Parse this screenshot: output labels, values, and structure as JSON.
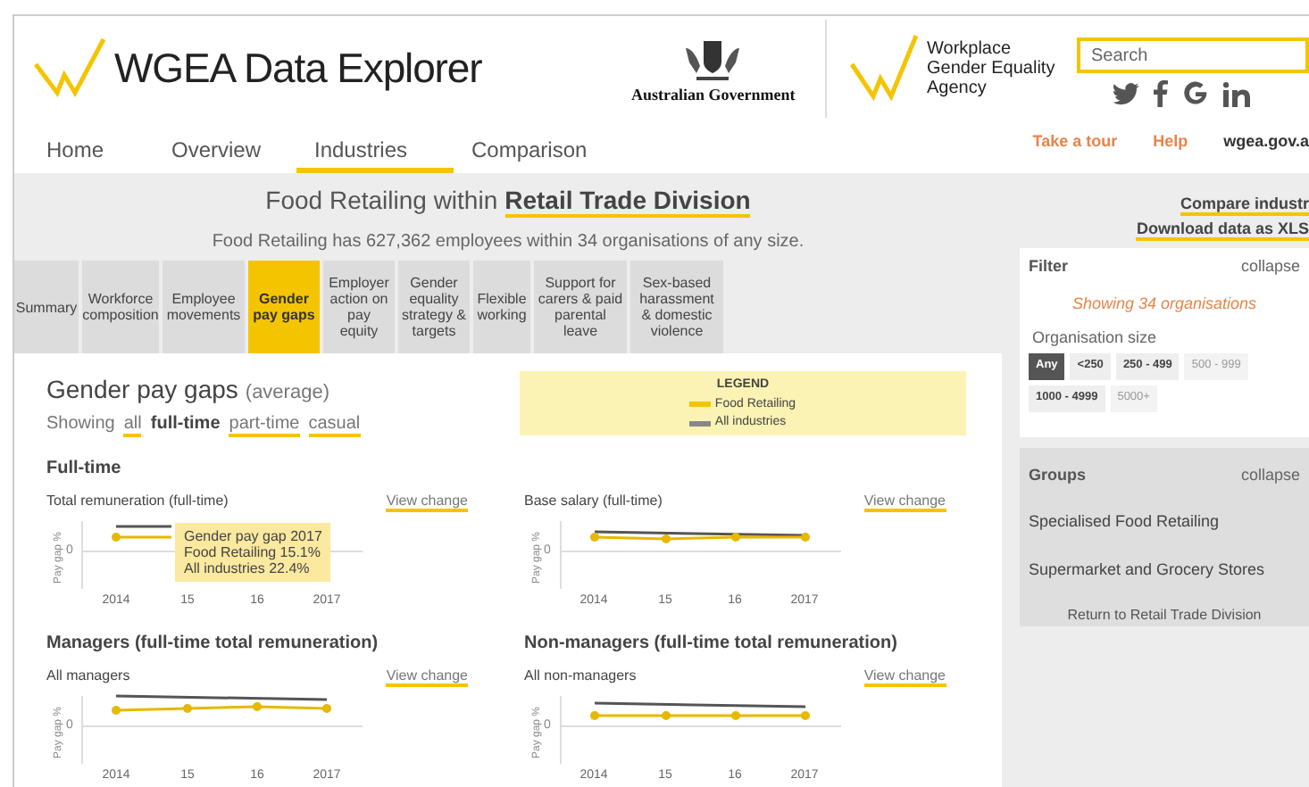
{
  "header": {
    "logo_text": "WGEA Data Explorer",
    "government": "Australian Government",
    "agency": [
      "Workplace",
      "Gender Equality",
      "Agency"
    ],
    "search": {
      "placeholder": "Search"
    }
  },
  "nav": {
    "tabs": [
      {
        "label": "Home",
        "selected": false
      },
      {
        "label": "Overview",
        "selected": false
      },
      {
        "label": "Industries",
        "selected": true
      },
      {
        "label": "Comparison",
        "selected": false
      }
    ],
    "links": [
      "Take a tour",
      "Help",
      "wgea.gov.a"
    ]
  },
  "title": {
    "prefix": "Food Retailing within",
    "link": "Retail Trade Division"
  },
  "subtitle": "Food Retailing has 627,362 employees within 34 organisations of any size.",
  "section_tabs": [
    {
      "label": "Summary",
      "selected": false
    },
    {
      "label": "Workforce composition",
      "selected": false
    },
    {
      "label": "Employee movements",
      "selected": false
    },
    {
      "label": "Gender pay gaps",
      "selected": true
    },
    {
      "label": "Employer action on pay equity",
      "selected": false
    },
    {
      "label": "Gender equality strategy & targets",
      "selected": false
    },
    {
      "label": "Flexible working",
      "selected": false
    },
    {
      "label": "Support for carers & paid parental leave",
      "selected": false
    },
    {
      "label": "Sex-based harassment & domestic violence",
      "selected": false
    }
  ],
  "content": {
    "heading": "Gender pay gaps",
    "heading_note": "(average)",
    "showing_label": "Showing",
    "filters": [
      {
        "label": "all",
        "selected": false
      },
      {
        "label": "full-time",
        "selected": true
      },
      {
        "label": "part-time",
        "selected": false
      },
      {
        "label": "casual",
        "selected": false
      }
    ],
    "legend": {
      "title": "LEGEND",
      "items": [
        {
          "label": "Food Retailing",
          "color": "#f5c400"
        },
        {
          "label": "All industries",
          "color": "#888888"
        }
      ]
    },
    "chart_rows": [
      {
        "heading": "Full-time",
        "charts": [
          {
            "title": "Total remuneration (full-time)",
            "link": "View change",
            "y_label": "Pay gap %",
            "zero": "0",
            "x_labels": [
              "2014",
              "15",
              "16",
              "2017"
            ],
            "tooltip": [
              "Gender pay gap 2017",
              "Food Retailing 15.1%",
              "All industries 22.4%"
            ]
          },
          {
            "title": "Base salary (full-time)",
            "link": "View change",
            "y_label": "Pay gap %",
            "zero": "0",
            "x_labels": [
              "2014",
              "15",
              "16",
              "2017"
            ]
          }
        ]
      },
      {
        "charts": [
          {
            "heading": "Managers (full-time total remuneration)",
            "title": "All managers",
            "link": "View change",
            "y_label": "Pay gap %",
            "zero": "0",
            "x_labels": [
              "2014",
              "15",
              "16",
              "2017"
            ]
          },
          {
            "heading": "Non-managers (full-time total remuneration)",
            "title": "All non-managers",
            "link": "View change",
            "y_label": "Pay gap %",
            "zero": "0",
            "x_labels": [
              "2014",
              "15",
              "16",
              "2017"
            ]
          }
        ]
      }
    ]
  },
  "sidebar": {
    "links": [
      "Compare industr",
      "Download data as XLS"
    ],
    "filter": {
      "title": "Filter",
      "collapse": "collapse",
      "status": "Showing 34 organisations",
      "size_label": "Organisation size",
      "sizes": [
        {
          "label": "Any",
          "selected": true,
          "disabled": false
        },
        {
          "label": "<250",
          "selected": false,
          "disabled": false
        },
        {
          "label": "250 - 499",
          "selected": false,
          "disabled": false
        },
        {
          "label": "500 - 999",
          "selected": false,
          "disabled": true
        },
        {
          "label": "1000 - 4999",
          "selected": false,
          "disabled": false
        },
        {
          "label": "5000+",
          "selected": false,
          "disabled": true
        }
      ]
    },
    "groups": {
      "title": "Groups",
      "collapse": "collapse",
      "items": [
        "Specialised Food Retailing",
        "Supermarket and Grocery Stores"
      ],
      "return": "Return to Retail Trade Division"
    }
  }
}
